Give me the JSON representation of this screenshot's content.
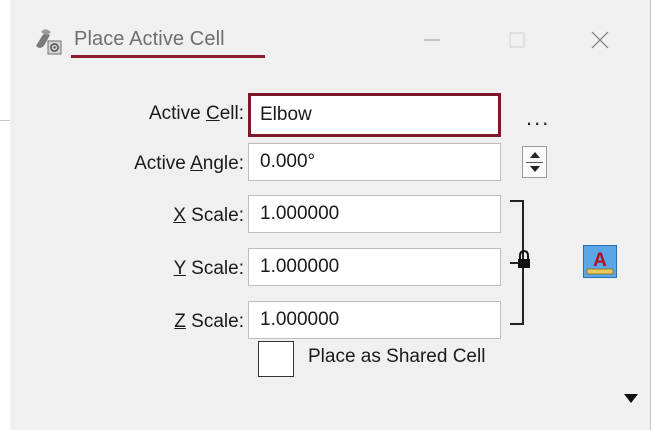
{
  "window": {
    "title": "Place Active Cell",
    "icon": "place-cell-tool-icon",
    "controls": [
      "minimize-icon",
      "maximize-icon",
      "close-icon"
    ]
  },
  "form": {
    "active_cell": {
      "label_pre": "Active ",
      "label_key": "C",
      "label_post": "ell:",
      "value": "Elbow"
    },
    "active_angle": {
      "label_pre": "Active ",
      "label_key": "A",
      "label_post": "ngle:",
      "value": "0.000°"
    },
    "x_scale": {
      "label_key": "X",
      "label_post": " Scale:",
      "value": "1.000000"
    },
    "y_scale": {
      "label_key": "Y",
      "label_post": " Scale:",
      "value": "1.000000"
    },
    "z_scale": {
      "label_key": "Z",
      "label_post": " Scale:",
      "value": "1.000000"
    },
    "shared_cell": {
      "label": "Place as Shared Cell",
      "checked": false
    },
    "browse_label": "..."
  },
  "colors": {
    "accent": "#8a1c2b",
    "dialog_bg": "#f0f0f0"
  }
}
